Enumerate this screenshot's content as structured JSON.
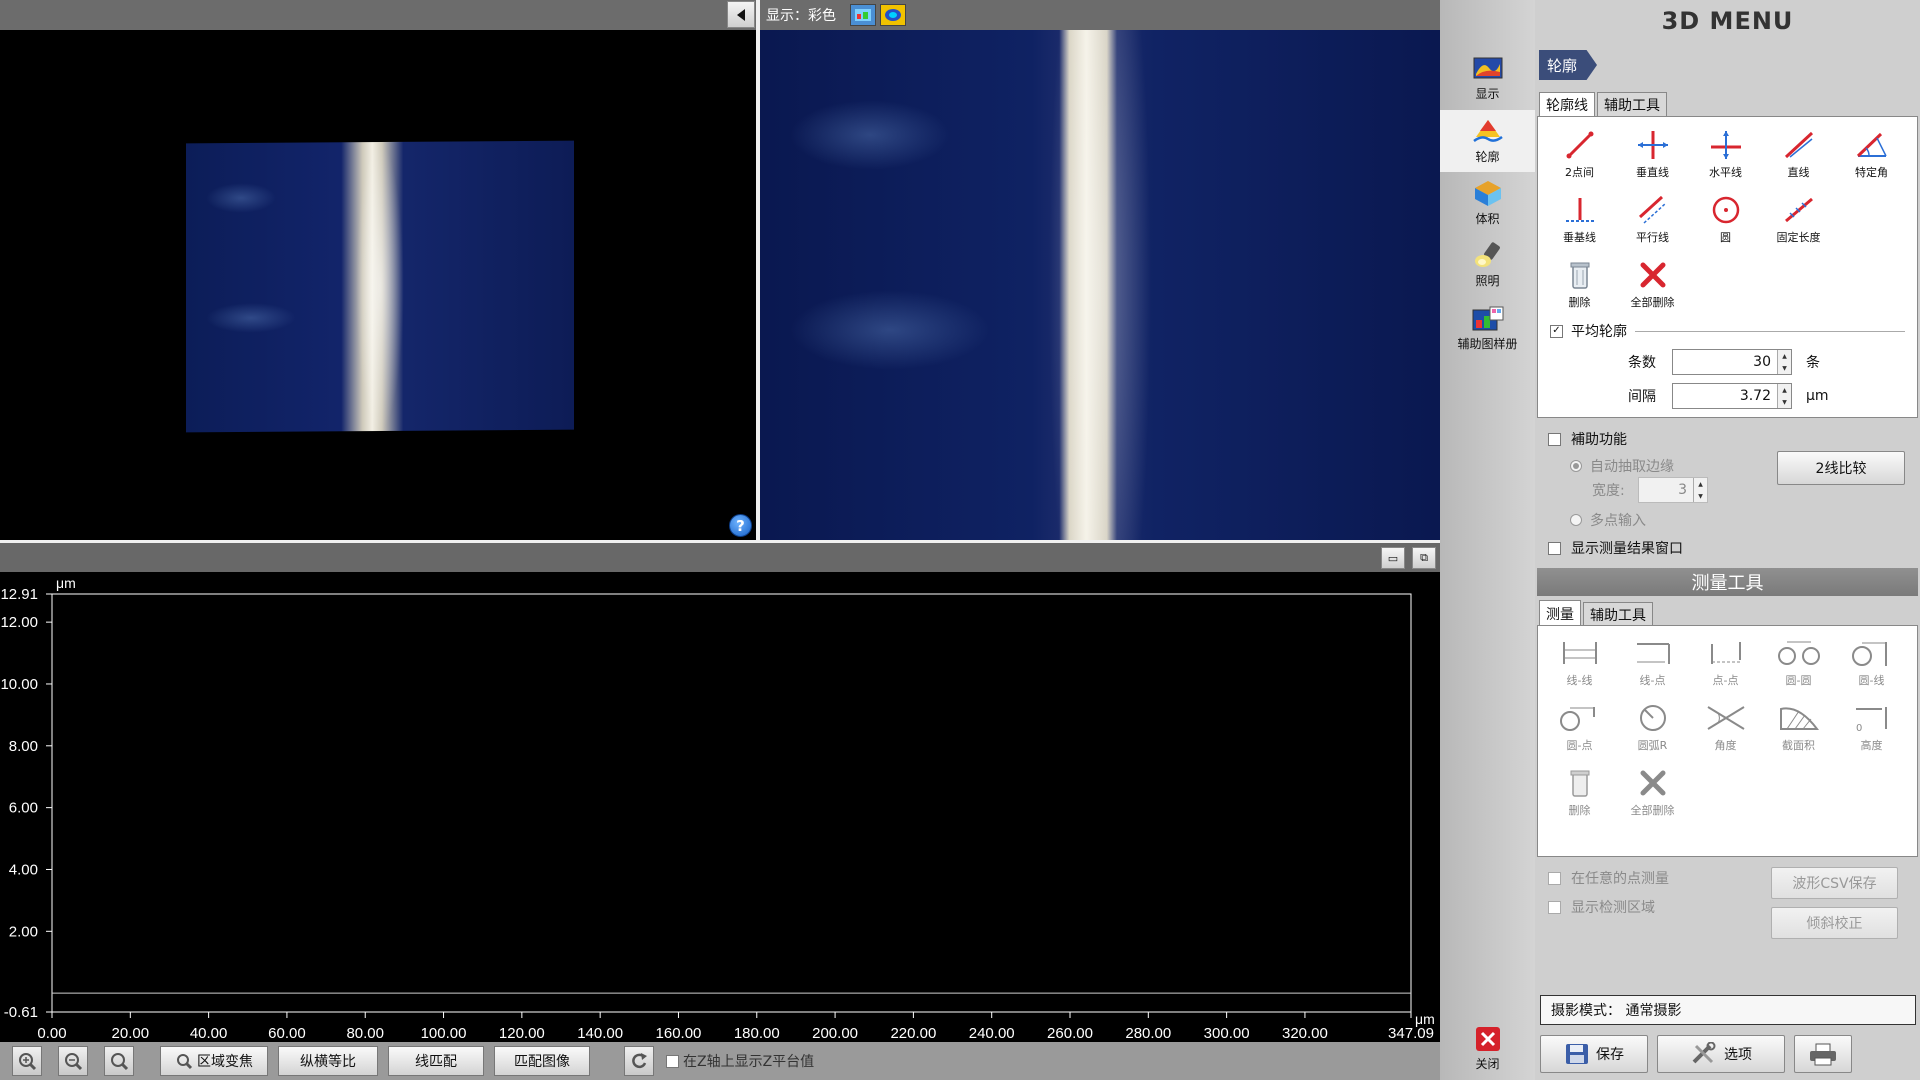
{
  "viewer": {
    "display_label": "显示：彩色",
    "help_symbol": "?"
  },
  "chart_data": {
    "type": "line",
    "xlabel": "μm",
    "ylabel": "μm",
    "xlim": [
      0.0,
      347.09
    ],
    "ylim": [
      -0.61,
      12.91
    ],
    "x_ticks": [
      "0.00",
      "20.00",
      "40.00",
      "60.00",
      "80.00",
      "100.00",
      "120.00",
      "140.00",
      "160.00",
      "180.00",
      "200.00",
      "220.00",
      "240.00",
      "260.00",
      "280.00",
      "300.00",
      "320.00",
      "347.09"
    ],
    "y_ticks": [
      "12.91",
      "12.00",
      "10.00",
      "8.00",
      "6.00",
      "4.00",
      "2.00",
      "-0.61"
    ],
    "series": [],
    "grid": false
  },
  "bottom_toolbar": {
    "buttons": [
      "区域变焦",
      "纵横等比",
      "线匹配",
      "匹配图像"
    ],
    "z_checkbox_label": "在Z轴上显示Z平台值"
  },
  "nav": {
    "items": [
      {
        "label": "显示",
        "icon": "display-icon"
      },
      {
        "label": "轮廓",
        "icon": "profile-icon"
      },
      {
        "label": "体积",
        "icon": "volume-icon"
      },
      {
        "label": "照明",
        "icon": "lighting-icon"
      },
      {
        "label": "辅助图样册",
        "icon": "pattern-book-icon"
      }
    ],
    "close_label": "关闭"
  },
  "panel": {
    "title": "3D MENU",
    "section_tag": "轮廓",
    "tabs": [
      "轮廓线",
      "辅助工具"
    ],
    "profile_tools": [
      {
        "label": "2点间",
        "icon": "two-point-line-icon"
      },
      {
        "label": "垂直线",
        "icon": "vertical-line-icon"
      },
      {
        "label": "水平线",
        "icon": "horizontal-line-icon"
      },
      {
        "label": "直线",
        "icon": "straight-line-icon"
      },
      {
        "label": "特定角",
        "icon": "specific-angle-icon"
      },
      {
        "label": "垂基线",
        "icon": "perpendicular-line-icon"
      },
      {
        "label": "平行线",
        "icon": "parallel-line-icon"
      },
      {
        "label": "圆",
        "icon": "circle-icon"
      },
      {
        "label": "固定长度",
        "icon": "fixed-length-icon"
      },
      {
        "label": "",
        "icon": ""
      },
      {
        "label": "删除",
        "icon": "trash-icon"
      },
      {
        "label": "全部删除",
        "icon": "delete-all-icon"
      }
    ],
    "avg_profile": {
      "label": "平均轮廓",
      "checked": true,
      "count_label": "条数",
      "count_value": "30",
      "count_unit": "条",
      "interval_label": "间隔",
      "interval_value": "3.72",
      "interval_unit": "μm"
    },
    "assist": {
      "label": "補助功能",
      "auto_edge": "自动抽取边缘",
      "width_label": "宽度:",
      "width_value": "3",
      "multi_input": "多点输入",
      "compare_button": "2线比较"
    },
    "show_result_window": "显示测量结果窗口",
    "measure": {
      "header": "测量工具",
      "tabs": [
        "测量",
        "辅助工具"
      ],
      "tools": [
        {
          "label": "线-线",
          "icon": "line-line-icon"
        },
        {
          "label": "线-点",
          "icon": "line-point-icon"
        },
        {
          "label": "点-点",
          "icon": "point-point-icon"
        },
        {
          "label": "圆-圆",
          "icon": "circle-circle-icon"
        },
        {
          "label": "圆-线",
          "icon": "circle-line-icon"
        },
        {
          "label": "圆-点",
          "icon": "circle-point-icon"
        },
        {
          "label": "圆弧R",
          "icon": "arc-radius-icon"
        },
        {
          "label": "角度",
          "icon": "angle-icon"
        },
        {
          "label": "截面积",
          "icon": "cross-section-icon"
        },
        {
          "label": "高度",
          "icon": "height-icon"
        },
        {
          "label": "删除",
          "icon": "trash-icon"
        },
        {
          "label": "全部删除",
          "icon": "delete-all-icon"
        }
      ],
      "any_point": "在任意的点测量",
      "show_detect_area": "显示检测区域",
      "csv_button": "波形CSV保存",
      "tilt_button": "倾斜校正"
    },
    "capture_mode": "摄影模式：  通常摄影",
    "save_button": "保存",
    "options_button": "选项"
  },
  "colors": {
    "profile_tool_accent": "#d8262f",
    "measure_tool_accent": "#8a8a8a",
    "image_background": "#0b1a55"
  }
}
